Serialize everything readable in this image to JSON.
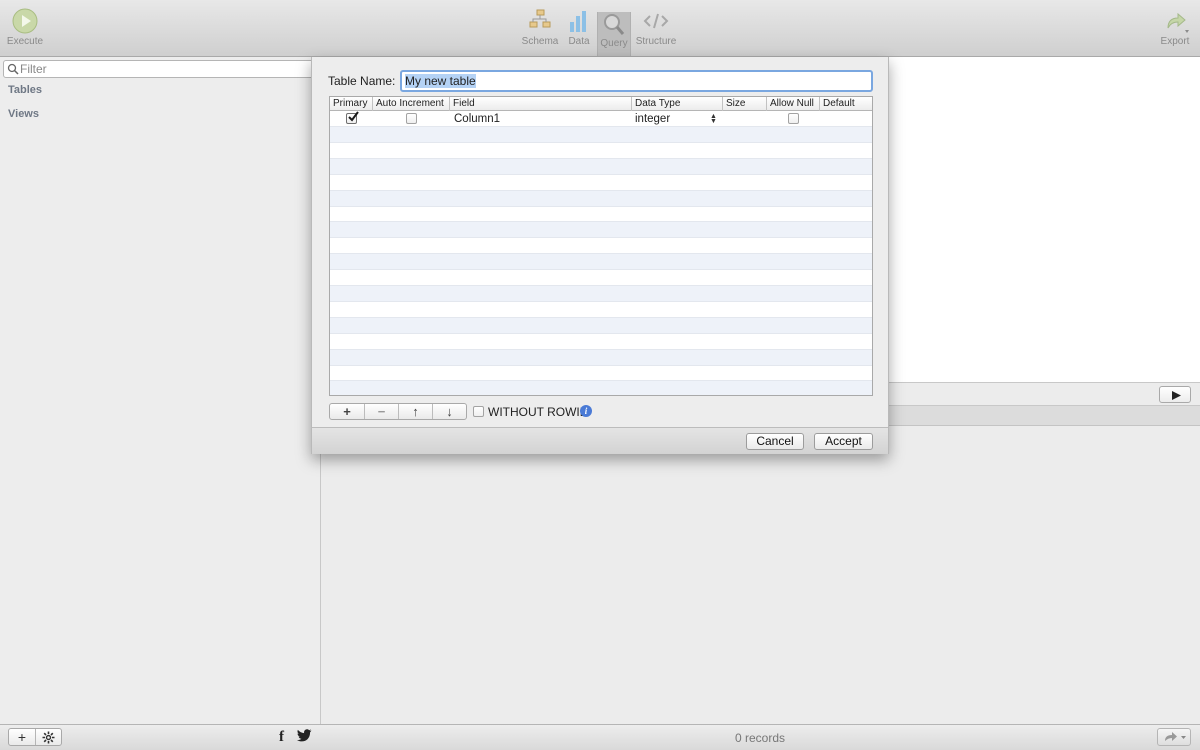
{
  "toolbar": {
    "execute_label": "Execute",
    "schema_label": "Schema",
    "data_label": "Data",
    "query_label": "Query",
    "structure_label": "Structure",
    "export_label": "Export"
  },
  "sidebar": {
    "filter_placeholder": "Filter",
    "sections": [
      {
        "label": "Tables"
      },
      {
        "label": "Views"
      }
    ]
  },
  "dialog": {
    "table_name_label": "Table Name:",
    "table_name_value": "My new table",
    "columns": [
      "Primary",
      "Auto Increment",
      "Field",
      "Data Type",
      "Size",
      "Allow Null",
      "Default"
    ],
    "rows": [
      {
        "primary": true,
        "auto_increment": false,
        "field": "Column1",
        "data_type": "integer",
        "size": "",
        "allow_null": false,
        "default": ""
      }
    ],
    "tools": [
      "+",
      "−",
      "↑",
      "↓"
    ],
    "without_rowid_label": "WITHOUT ROWID",
    "without_rowid_checked": false,
    "cancel_label": "Cancel",
    "accept_label": "Accept"
  },
  "status": {
    "records": "0 records"
  },
  "colors": {
    "selection": "#b4d2f5",
    "focus_ring": "#7aa7e0",
    "row_stripe": "#eef2f9",
    "info": "#4a7ad6"
  }
}
